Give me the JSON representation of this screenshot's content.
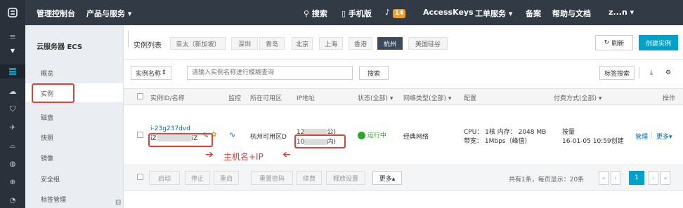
{
  "topbar": {
    "console": "管理控制台",
    "products": "产品与服务 ▾",
    "search": "搜索",
    "mobile": "手机版",
    "notice_count": "14",
    "accesskeys": "AccessKeys",
    "tickets": "工单服务 ▾",
    "record": "备案",
    "help": "帮助与文档",
    "user": "z...n ▾"
  },
  "sidebar": {
    "title": "云服务器 ECS",
    "items": [
      "概览",
      "实例",
      "磁盘",
      "快照",
      "镜像",
      "安全组",
      "标签管理"
    ]
  },
  "header": {
    "title": "实例列表",
    "regions": [
      "亚太（新加坡）",
      "深圳",
      "青岛",
      "北京",
      "上海",
      "香港",
      "杭州",
      "美国硅谷"
    ],
    "active_region": "杭州",
    "refresh": "刷新",
    "create": "创建实例"
  },
  "filter": {
    "select": "实例名称",
    "placeholder": "请输入实例名称进行模糊查询",
    "search": "搜索",
    "tag_search": "标签搜索"
  },
  "columns": [
    "实例ID/名称",
    "监控",
    "所在可用区",
    "IP地址",
    "状态(全部) ▾",
    "网络类型(全部) ▾",
    "配置",
    "付费方式(全部) ▾",
    "操作"
  ],
  "row": {
    "id": "i-23g237dvd",
    "name_prefix": "iZ",
    "name_suffix": "iZ",
    "zone": "杭州可用区D",
    "ip_prefix_1": "12",
    "ip_suffix_1": "公)",
    "ip_prefix_2": "10",
    "ip_suffix_2": "内)",
    "status": "运行中",
    "network": "经典网络",
    "config_cpu": "CPU： 1核  内存： 2048 MB",
    "config_bw": "带宽： 1Mbps（峰值）",
    "pay_type": "按量",
    "pay_created": "16-01-05 10:59创建",
    "manage": "管理",
    "more": "更多▾"
  },
  "annotation": "主机名+IP",
  "footer": {
    "buttons": [
      "启动",
      "停止",
      "重启",
      "重置密码",
      "续费",
      "释放设置"
    ],
    "more": "更多▴",
    "summary": "共有1条，每页显示：20条",
    "page": "1"
  },
  "colors": {
    "topbar": "#323a46",
    "accent": "#00a2ca",
    "highlight": "#e0403a",
    "status": "#2aaa2a"
  }
}
